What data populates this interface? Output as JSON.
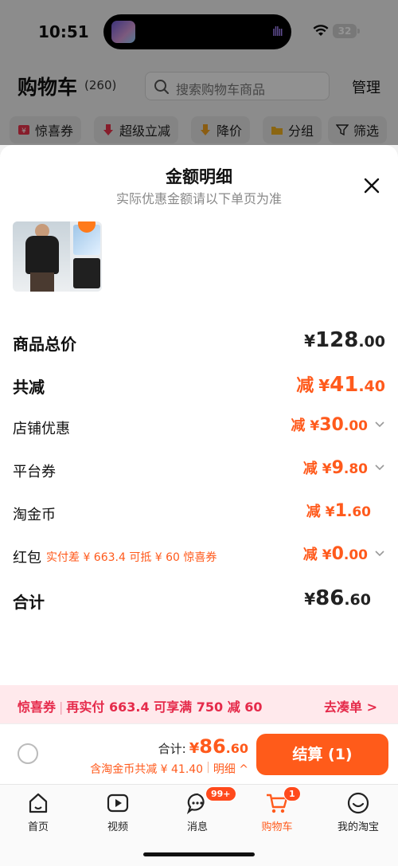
{
  "status_bar": {
    "time": "10:51",
    "battery": "32"
  },
  "cart": {
    "title": "购物车",
    "count": "(260)",
    "search_placeholder": "搜索购物车商品",
    "manage_label": "管理",
    "filters": [
      {
        "label": "惊喜券",
        "icon": "coupon-icon"
      },
      {
        "label": "超级立减",
        "icon": "arrow-down-icon"
      },
      {
        "label": "降价",
        "icon": "price-drop-icon"
      },
      {
        "label": "分组",
        "icon": "folder-icon"
      },
      {
        "label": "筛选",
        "icon": "filter-icon"
      }
    ]
  },
  "sheet": {
    "title": "金额明细",
    "subtitle": "实际优惠金额请以下单页为准",
    "rows": {
      "total_price": {
        "label": "商品总价",
        "yen": "¥",
        "int": "128",
        "dec": ".00"
      },
      "total_discount": {
        "label": "共减",
        "minus": "减",
        "yen": "¥",
        "int": "41",
        "dec": ".40"
      },
      "store_discount": {
        "label": "店铺优惠",
        "minus": "减",
        "yen": "¥",
        "int": "30",
        "dec": ".00"
      },
      "platform_coupon": {
        "label": "平台券",
        "minus": "减",
        "yen": "¥",
        "int": "9",
        "dec": ".80"
      },
      "taojinbi": {
        "label": "淘金币",
        "minus": "减",
        "yen": "¥",
        "int": "1",
        "dec": ".60"
      },
      "red_packet": {
        "label": "红包",
        "note": "实付差 ¥ 663.4 可抵 ¥ 60 惊喜券",
        "minus": "减",
        "yen": "¥",
        "int": "0",
        "dec": ".00"
      },
      "subtotal": {
        "label": "合计",
        "yen": "¥",
        "int": "86",
        "dec": ".60"
      }
    }
  },
  "promo": {
    "tag": "惊喜券",
    "text": "再实付 663.4 可享满 750 减 60",
    "link": "去凑单 >"
  },
  "checkout": {
    "total_label": "合计:",
    "yen": "¥",
    "int": "86",
    "dec": ".60",
    "saving_text": "含淘金币共减 ¥ 41.40",
    "detail_label": "明细",
    "button_label": "结算 (1)"
  },
  "tabs": [
    {
      "label": "首页",
      "icon": "home-icon"
    },
    {
      "label": "视频",
      "icon": "video-icon"
    },
    {
      "label": "消息",
      "icon": "message-icon",
      "badge": "99+"
    },
    {
      "label": "购物车",
      "icon": "cart-icon",
      "badge": "1",
      "active": true
    },
    {
      "label": "我的淘宝",
      "icon": "profile-icon"
    }
  ],
  "colors": {
    "accent": "#ff5a1c",
    "promo_bg": "#ffe9ec",
    "promo_text": "#e52a4a"
  }
}
